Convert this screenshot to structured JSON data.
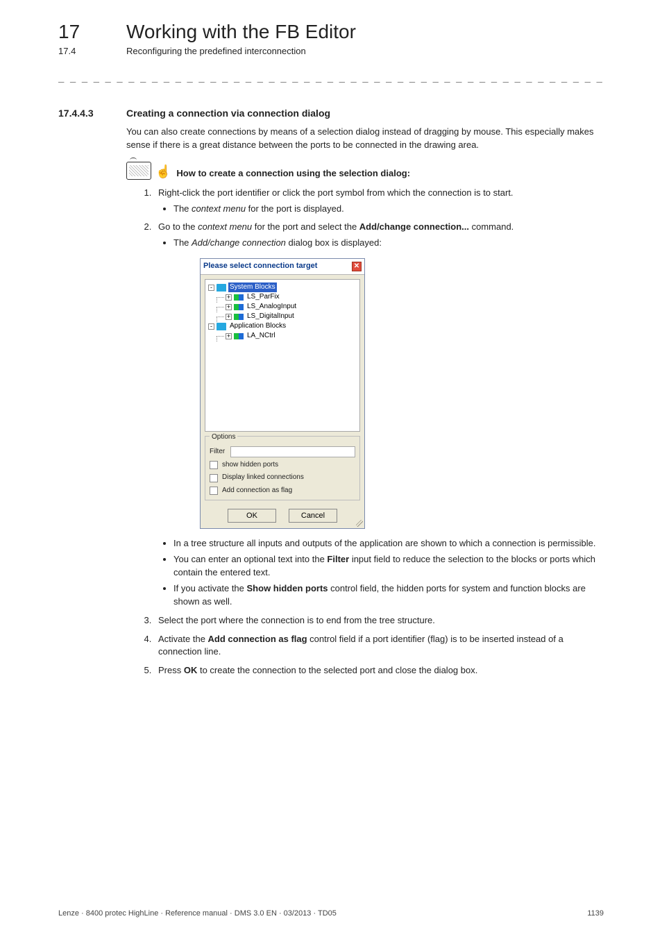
{
  "header": {
    "chapter_num": "17",
    "chapter_title": "Working with the FB Editor",
    "subsection_num": "17.4",
    "subsection_title": "Reconfiguring the predefined interconnection",
    "rule": "_ _ _ _ _ _ _ _ _ _ _ _ _ _ _ _ _ _ _ _ _ _ _ _ _ _ _ _ _ _ _ _ _ _ _ _ _ _ _ _ _ _ _ _ _ _ _ _ _ _ _ _ _ _ _ _ _ _ _ _ _ _ _ _"
  },
  "section": {
    "num": "17.4.4.3",
    "title": "Creating a connection via connection dialog",
    "intro": "You can also create connections by means of a selection dialog instead of dragging by mouse. This especially makes sense if there is a great distance between the ports to be connected in the drawing area.",
    "howto": "How to create a connection using the selection dialog:"
  },
  "steps": {
    "s1": "Right-click the port identifier or click the port symbol from which the connection is to start.",
    "s1_bullets": {
      "b1_prefix": "The ",
      "b1_em": "context menu",
      "b1_suffix": " for the port is displayed."
    },
    "s2_prefix": "Go to the ",
    "s2_em": "context menu",
    "s2_mid": " for the port and select the ",
    "s2_bold": "Add/change connection...",
    "s2_suffix": " command.",
    "s2b_prefix": "The ",
    "s2b_em": "Add/change connection",
    "s2b_suffix": " dialog box is displayed:",
    "s2_note1": "In a tree structure all inputs and outputs of the application are shown to which a connection is permissible.",
    "s2_note2_prefix": "You can enter an optional text into the ",
    "s2_note2_bold": "Filter",
    "s2_note2_suffix": " input field to reduce the selection to the blocks or ports which contain the entered text.",
    "s2_note3_prefix": "If you activate the ",
    "s2_note3_bold": "Show hidden ports",
    "s2_note3_suffix": " control field, the hidden ports for system and function blocks are shown as well.",
    "s3": "Select the port where the connection is to end from the tree structure.",
    "s4_prefix": "Activate the ",
    "s4_bold": "Add connection as flag",
    "s4_suffix": " control field if a port identifier (flag) is to be inserted instead of a connection line.",
    "s5_prefix": "Press ",
    "s5_bold": "OK",
    "s5_suffix": " to create the connection to the selected port and close the dialog box."
  },
  "dialog": {
    "title": "Please select connection target",
    "tree": {
      "n0": "System Blocks",
      "n0a": "LS_ParFix",
      "n0b": "LS_AnalogInput",
      "n0c": "LS_DigitalInput",
      "n1": "Application Blocks",
      "n1a": "LA_NCtrl"
    },
    "options": {
      "legend": "Options",
      "filter_label": "Filter",
      "chk1": "show hidden ports",
      "chk2": "Display linked connections",
      "chk3": "Add connection as flag"
    },
    "buttons": {
      "ok": "OK",
      "cancel": "Cancel"
    }
  },
  "footer": {
    "left": "Lenze · 8400 protec HighLine · Reference manual · DMS 3.0 EN · 03/2013 · TD05",
    "right": "1139"
  }
}
